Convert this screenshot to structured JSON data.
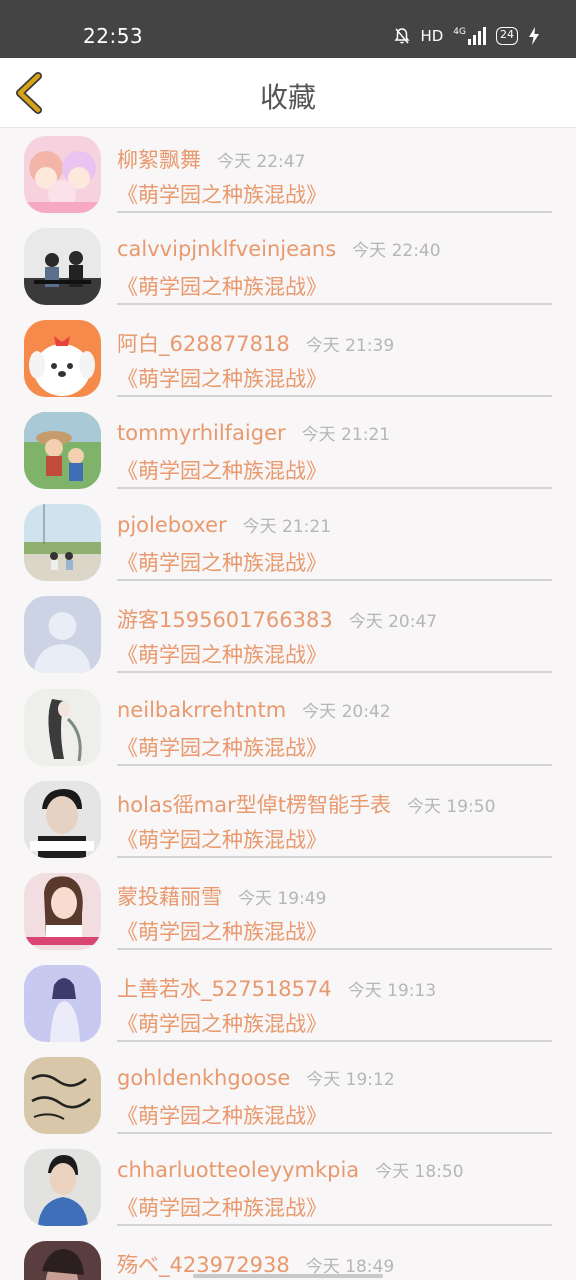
{
  "status_bar": {
    "time": "22:53",
    "network": "HD",
    "signal": "4G",
    "battery": "24"
  },
  "header": {
    "title": "收藏",
    "back_icon": "chevron-left-icon",
    "accent_color": "#d9a318"
  },
  "items": [
    {
      "name": "柳絮飘舞",
      "time": "今天 22:47",
      "title": "《萌学园之种族混战》"
    },
    {
      "name": "calvvipjnklfveinjeans",
      "time": "今天 22:40",
      "title": "《萌学园之种族混战》"
    },
    {
      "name": "阿白_628877818",
      "time": "今天 21:39",
      "title": "《萌学园之种族混战》"
    },
    {
      "name": "tommyrhilfaiger",
      "time": "今天 21:21",
      "title": "《萌学园之种族混战》"
    },
    {
      "name": "pjoleboxer",
      "time": "今天 21:21",
      "title": "《萌学园之种族混战》"
    },
    {
      "name": "游客1595601766383",
      "time": "今天 20:47",
      "title": "《萌学园之种族混战》"
    },
    {
      "name": "neilbakrrehtntm",
      "time": "今天 20:42",
      "title": "《萌学园之种族混战》"
    },
    {
      "name": "holas徭mar型倬t楞智能手表",
      "time": "今天 19:50",
      "title": "《萌学园之种族混战》"
    },
    {
      "name": "蒙投藉丽雪",
      "time": "今天 19:49",
      "title": "《萌学园之种族混战》"
    },
    {
      "name": "上善若水_527518574",
      "time": "今天 19:13",
      "title": "《萌学园之种族混战》"
    },
    {
      "name": "gohldenkhgoose",
      "time": "今天 19:12",
      "title": "《萌学园之种族混战》"
    },
    {
      "name": "chharluotteoleyymkpia",
      "time": "今天 18:50",
      "title": "《萌学园之种族混战》"
    },
    {
      "name": "殇ベ_423972938",
      "time": "今天 18:49",
      "title": ""
    }
  ]
}
